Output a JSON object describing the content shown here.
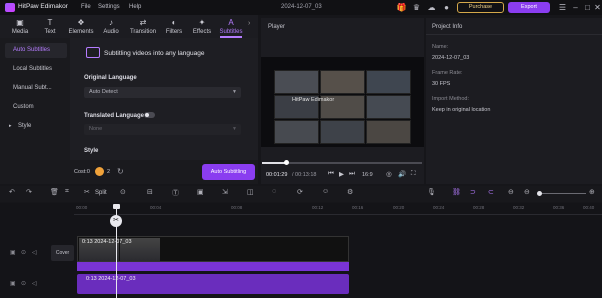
{
  "titlebar": {
    "app_title": "HitPaw Edimakor",
    "menu": [
      "File",
      "Settings",
      "Help"
    ],
    "window_title": "2024-12-07_03",
    "purchase_label": "Purchase",
    "export_label": "Export"
  },
  "tool_tabs": [
    {
      "label": "Media",
      "icon": "media-icon"
    },
    {
      "label": "Text",
      "icon": "text-icon"
    },
    {
      "label": "Elements",
      "icon": "elements-icon"
    },
    {
      "label": "Audio",
      "icon": "audio-icon"
    },
    {
      "label": "Transition",
      "icon": "transition-icon"
    },
    {
      "label": "Filters",
      "icon": "filters-icon"
    },
    {
      "label": "Effects",
      "icon": "effects-icon"
    },
    {
      "label": "Subtitles",
      "icon": "subtitles-icon",
      "active": true
    }
  ],
  "subnav": [
    {
      "label": "Auto Subtitles",
      "active": true
    },
    {
      "label": "Local Subtitles"
    },
    {
      "label": "Manual Subt..."
    },
    {
      "label": "Custom"
    },
    {
      "label": "Style"
    }
  ],
  "panel": {
    "heading": "Subtitling videos into any language",
    "original_language_label": "Original Language",
    "original_language_value": "Auto Detect",
    "translated_language_label": "Translated Language",
    "translated_language_value": "None",
    "style_label": "Style",
    "cost_label": "Cost:0",
    "cost_count": "2",
    "auto_button": "Auto Subtitling"
  },
  "player": {
    "label": "Player",
    "video_caption": "HitPaw Edimakor",
    "time_current": "00:01:29",
    "time_total": "/ 00:13:18",
    "ratio": "16:9",
    "progress": 0.15
  },
  "project_info": {
    "title": "Project Info",
    "fields": [
      {
        "key": "Name:",
        "value": "2024-12-07_03"
      },
      {
        "key": "Frame Rate:",
        "value": "30 FPS"
      },
      {
        "key": "Import Method:",
        "value": "Keep in original location"
      }
    ]
  },
  "toolbar": {
    "split_label": "Split"
  },
  "timeline": {
    "ruler_ticks": [
      "00:00",
      "00:04",
      "00:08",
      "00:12",
      "00:16",
      "00:20",
      "00:24",
      "00:28",
      "00:32",
      "00:36",
      "00:40",
      "00:44"
    ],
    "cover_label": "Cover",
    "video_clip_label": "0:13  2024-12-07_03",
    "audio_clip_label": "0:13  2024-12-07_03"
  },
  "colors": {
    "accent": "#b57cff",
    "primary_button": "#8a3df0",
    "purchase_gold": "#d4a84a",
    "background": "#16161a"
  }
}
